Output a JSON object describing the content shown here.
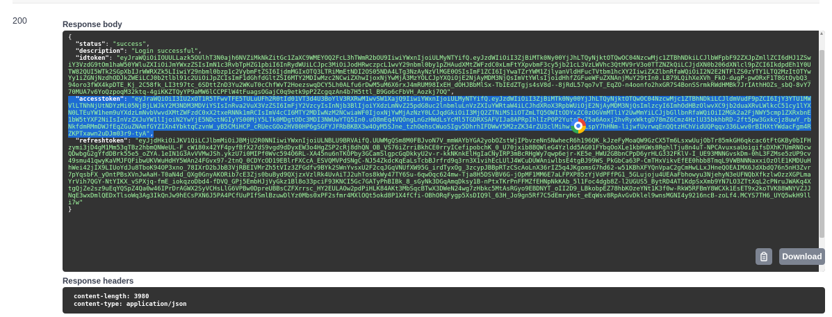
{
  "response": {
    "code": "200",
    "body_label": "Response body",
    "headers_label": "Response headers",
    "json": {
      "open": "{",
      "close": "}",
      "status_key": "\"status\"",
      "status_val": "\"success\"",
      "description_key": "\"description\"",
      "description_val": "\"Login successful\"",
      "idtoken_key": "\"idtoken\"",
      "idtoken_val": "\"eyJraWQiOiIOUULLazk5OUlhT3N0ajh6NVZiMkNkZitGc1ZaXC9WMEYOQ2FcL3hTWmR2bOU9IiwiYWxnIjoiULMyNTYifQ.eyJzdWIiOiI3ZjBiMTk0Ny00YjJhLTQyNjktOTQwOC04NzcwMjc1ZTBhNDkiLCJlbWFpbF92ZXJpZmllZCI6dHJ1ZSwiY3VzdG9tOm1haW50YWluZXIiOiJmYWxzZSIsImN1c3RvbTpHZG1pbiI6InRydWUiLCJpc3MiOiJodHRwczpcL1wvY29nbml0by1pZHAudXMtZWFzdC0xLmFtYXpvbmF3cy5jb21cL3VzLWVhc3QtMV9rV3o0TTZNZkQiLCJjdXN0b206dXNlcl9pZCI6IkdpdEh1Y0UTW82QUI5WTk2SGpXbIJrWWRXZk5LIiwiY29nbml0bzp1c2VybmFtZSI6IjdmMGIxOTQ3LTRiMmEtNDI2OS05NDA4LTg3NzAyNzVlMGE0OSIsImF1ZCI6IjYwaTZrYWM1ZjlyanVldHFucTVtbm1hcXY2IiwiZXZlbnRfaWQiOiI2N2E2NTFlZS0zYTY1LTQ2MzItOTYwYy1iZGNjNzdhODJkZWEiLCJ0b2tlbl91c2UiOiJpZCIsImF1dGhfdGltZSI6MTY2MDIwMzc2NCwiZXhwIjoxNjYwMjA3MzYOLCJpYXQiOjE2NjAyMDM3NjQsImVtYWlsIjoidHhfZGFueWFuZXNAnjMuY29tIn0.LB79LQihXeXVh_FkO-dugP-pwORxF1T8GtOybQ3_94oro3fWX4kpDTE_Kj_2C58fk_LI3t97tc_6SDttZnD3Yu2WKuT0cChfWvT2HoezswqDCY5Lh0ALfu6rDwM5uM6X6rxJ4mRUM98IxEH_dOHJBbMlSx-TbIEdZTgjs4sV8d--8jRdL57qo7vT_EqZO-n4oonfo2hxGR7S4BonSSrmkRWdHMBk7JrIAthHOZs_sbQ-8vY770MUA7v6YoQzpoqM32ktq-4giKKZTQyYP9aMW6lCCPFlW4tFuagsOGajC0q9etk9pP2ZcgqzAn4b7H5ttl_B9Go6cFbVH_Aozkj7OQ\"",
      "accesstoken_key": "\"accesstoken\"",
      "accesstoken_val": "\"eyJraWQiOiI3IU2xOT1R5TFwvTFE5TULuUFh2R0tId01VT3d4U3BoYlV3RXRwM1wvSW1XajQ9IiwiYWxnIjoiULMyNTYifQ.eyJzdWIiOiI3ZjBiMTk0Ny00YjJhLTQyNjktOTQwOC04NzcwMjc1ZTBhNDkiLCJldmVudF9pZCI6IjY3YTU1MWVlLTNhNjUtNDYzMi05NjBjLWJkY2M3NDM3MDViYSIsInRva2VuX3VzZSI6ImFjY2VzcyIsInNjb3BlIjoiYXdzLmNvZ25pdG8uc2lnbmluLnVzZXIuYWRtaW4iLCJhdXRoX3RpbWUiOjE2NjAyMDM3NjQsImlzcyI6ImhOdHBzOlwvXC9jb2duaXRvLWlkcC51cy1lYXN0LTEuYW1hem9uYXdzLmNvbVwvdXMtZWFzdC0xX2txeRNNk1mRCIsImV4cCI6MTY2MDIwNzM2NCwiaWF0IjoxNjYwMjAzNzY0LCJqdGkiOiI3MjQ2ZTNiMS1iOTZmLTQ5OWItODYxZC0zOGVmMTliY2UwMmYiLCJjbGllbnRfaWQiOiI2MGk2a2FjNWY5cmp1ZXRxbnE1bW5tYXF2NiIsInVzZXJuYW1lIjoiN2YwYjE5NDctNGIyYS00MjY5LTk0MDgtODc3MDI3NWUwYTQ5In0.uO8mEq4VQOngLnGzHWdLsYcMl5TGDRXSAFVIJa8APRpIhlIzPOP2YutsEy75a6Aoxj2hvRyxWktgD78mZ6Cmz4HzlU35bkhbRD-2ft5pw3Gxkcjz8uwY_rbNkfdmRMmDWJfEqZGuZNAmfGYZIXn4YbktqCzvnW_yB5CMiHCP_cRUecGOo2HV80HP6gSGFYJFRbBKBX3w4OyM5SJne_tzhOehsCWuoSIgv5DhrhIFDWwY5M2zZK34rZU3clMihw_7SBLspY7hHNm-lijwfUvrwqEnQQtzHChVidUQPqqv336Lwv0rBIHXtYWdacFgm4RZKPTxawn2uDJm03r9-tyA\"",
      "refreshtoken_key": "\"refreshtoken\"",
      "refreshtoken_val": "\"eyJjdHkiOiJKV1QiLCJlbmMiOiJBMjU2R0NNIiwiYWxnIjoiULNBLU9BRVAifQ.UUWMgQSm8M0FBJvoN7V_mmWAYbYGA2yobOZstWjIPbvzeNnSNwhecR6h196QK_kJzeFyMoaQW9GzCX5Tm6LsxwUujObTr85mkGH6qkcac6tFtGKBy0bIFHzymi3jD4gM1Mm53qTBz2hbmQNWeUL-F_cW180x42YF4pyfBfX27dS9vgd9dDyxEW3o4HgZSP2cRj8dhQN_OB_VS76iZrriBkhCE0rryICefipobchK_0_U70jxib8BQWleG4Yzldd5AG01FYbqOoXLe1kbHGWs8RghlTju8n4uT-NPCAvuxsaUoigifsDXhK7UmRNOcwQDwbgG2gYfdDBrk55e5_oZYA.1eIN1G3AvVVMwJSh.ykzU7i0MIPf0Wvc594O6RL-XA45nu6nTKOPby3GCamSlgpcGqDkkyU2v-r-kkNKnkElHgIaCNyIRP3mBcRHgWy7qwp6ejr-KE5e_HWU2GBbnCPpD6yrHLG332FKlV-I_UE93MNNGvskDm-0hL3FZMse5zUP9cv49smu41qwyKaVMJFQFibwUKVWuHdHY5WAn24FGvx97-2tnQ_0CDYcOD19EBlrFXCcA_ESVQMVPdSNgC-NJ54ZkdcKqEaLsTcbBJrfrd9q3rn3X1vihEcLUlJ4WCuDUWAniwlbsE4tgBJ99WS_PkGbCa63P-CmTHxVikvEfEE0hbb8TmqL9VWBNNNaxxiOzOlE1KMDUuHhWei42jIX9LIUoYdJu8TboK94OP3xno_78IXrD2bJbB3VjRBEIVMrZh5tVIz3ZFGdfv9BYk2SWnYvsxU2F2cqJGqVNUfXW95G_irdTyxOg_3zcypJBBpRTzCScAoLnX36rIZ5q4JKgomsG7hd62-w51KBhXFYQnVpaC2gCmHwLLxJHneQOEAIMX6JdXbdQ76n5nH3Zvr7pYqsbFX_yOntPBsXVnJwAaH-T0aN4d_QXg0GnyAKORib7cE3Zjs0buByd9QXjzxVzlRk4UvAiTJ2uhTos8kWy47TY6Su-6qwOqc624mw-Tja8H5DSVBV6G-jOpMF1MM6E7aLFPXP85zYjVdPFfPG1_5GLujoju4UEAaFbhowyu3NjehyN3eUFNQbXfkzlwOzzXGPLmaYrVih7QGY-NtYIKX_vSPXjq-fmE_iokqzoDbd4-fDVQ_GPj5EmbHJjVyGkz1Bl8o33pciF93KNCI5Gc7GATyPhBIBk_8_sGyNk3DGqAmqDksy1B-nPtxTKrPnFFMZfEHNpNkKAb_5l1Foc4dgb8Z-l2UGUS5_BytRD4AT1KdpSxXmb9YN7LO3ZTtXqL2cPNruJWAKq4XtgQjZe2sz9uEqYQSpZ4Qa0w46IPrDrAGWX2SyVCHsLlG6VPBw0DpreUBBsCZFXrrsc_HY2EULAOw2pdPiHLK84AKt3MbSqcBTwX3DWeN24wg7zHbkc5MtAsRGyo9EBDNYT_oII2D9_LBkobpEZ78hbKOzeYNt1K3f0w-RkW5RFBmY8WCXk1EsET9x2koTVK88WNYVZJJNqE3wxDmlQEDxTlsoWq3Ag3IkQnJw9hECsPXN6J5PA4PCfUuPIfSmlBzuwDlYz0Mbs0xPF2sfmr4MXlOQt5okd8P1X4fCfi-OBhORqFygp5XsDIQ9l_63H_Jo9gn5Rf7C5dEmryHot_eEqWsv8RpAvGvDklel9wnsMGNI4y9216ncB-zoLf4.MCYS7TH6_UYQ5wkH9lli7w\""
    },
    "headers_lines": [
      "content-length: 3980",
      "content-type: application/json"
    ],
    "download_label": "Download",
    "colors": {
      "panel_bg": "#333333",
      "string": "#a2fca2",
      "selection": "#1e6cd4",
      "button_bg": "#7d8492"
    },
    "icons": [
      "copy-icon",
      "extension-icon"
    ]
  }
}
